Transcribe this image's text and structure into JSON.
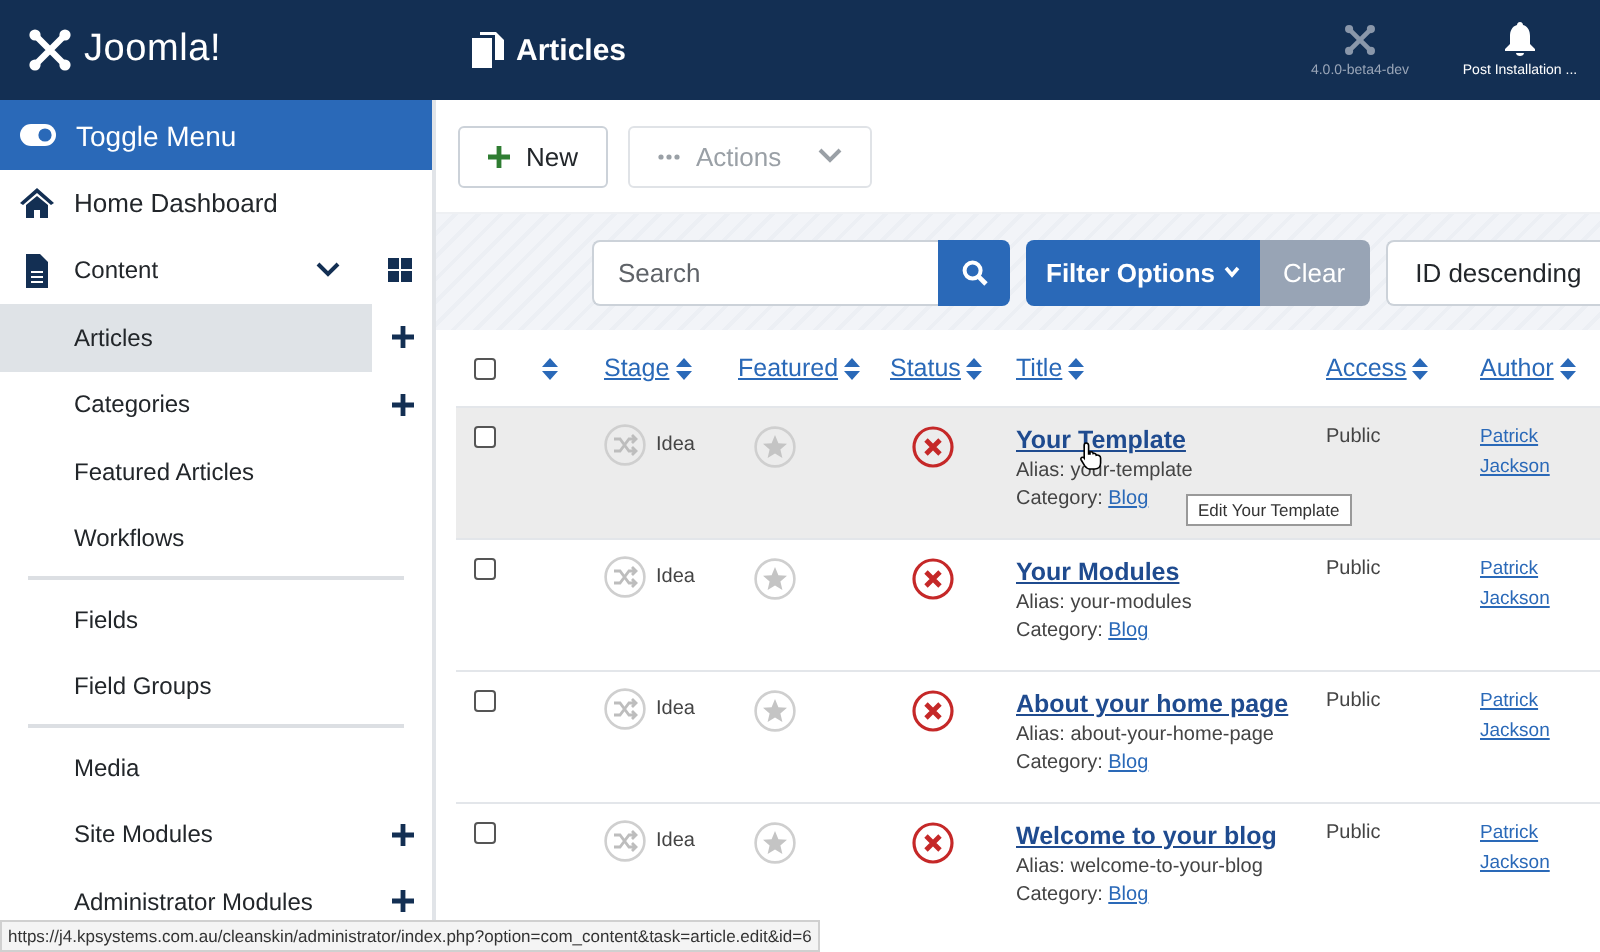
{
  "header": {
    "logo": "Joomla!",
    "title": "Articles",
    "version": "4.0.0-beta4-dev",
    "notifications": "Post Installation ..."
  },
  "sidebar": {
    "toggle": "Toggle Menu",
    "items": [
      {
        "kind": "home",
        "label": "Home Dashboard"
      },
      {
        "kind": "section",
        "label": "Content",
        "expanded": true,
        "children": [
          {
            "kind": "link",
            "label": "Articles",
            "selected": true,
            "add": true
          },
          {
            "kind": "link",
            "label": "Categories",
            "selected": false,
            "add": true
          },
          {
            "kind": "link",
            "label": "Featured Articles",
            "selected": false,
            "add": false
          },
          {
            "kind": "link",
            "label": "Workflows",
            "selected": false,
            "add": false
          },
          {
            "kind": "divider"
          },
          {
            "kind": "link",
            "label": "Fields",
            "selected": false,
            "add": false
          },
          {
            "kind": "link",
            "label": "Field Groups",
            "selected": false,
            "add": false
          },
          {
            "kind": "divider"
          },
          {
            "kind": "link",
            "label": "Media",
            "selected": false,
            "add": false
          },
          {
            "kind": "link",
            "label": "Site Modules",
            "selected": false,
            "add": true
          },
          {
            "kind": "link",
            "label": "Administrator Modules",
            "selected": false,
            "add": true
          }
        ]
      }
    ]
  },
  "toolbar": {
    "buttons": [
      {
        "kind": "new",
        "label": "New",
        "disabled": false
      },
      {
        "kind": "actions",
        "label": "Actions",
        "disabled": true
      }
    ]
  },
  "filters": {
    "search": {
      "placeholder": "Search"
    },
    "filter_options": "Filter Options",
    "clear": "Clear",
    "sort": "ID descending"
  },
  "table": {
    "columns": [
      {
        "kind": "check",
        "checked": false
      },
      {
        "kind": "order"
      },
      {
        "kind": "sort",
        "label": "Stage"
      },
      {
        "kind": "sort",
        "label": "Featured"
      },
      {
        "kind": "sort",
        "label": "Status"
      },
      {
        "kind": "sort",
        "label": "Title"
      },
      {
        "kind": "sort",
        "label": "Access"
      },
      {
        "kind": "sort",
        "label": "Author"
      }
    ],
    "rows": [
      {
        "checked": false,
        "hovered": true,
        "stage": "Idea",
        "featured": false,
        "published": false,
        "title": "Your Template",
        "alias": "Alias: your-template",
        "category_label": "Category:",
        "category": "Blog",
        "access": "Public",
        "author": "Patrick Jackson"
      },
      {
        "checked": false,
        "hovered": false,
        "stage": "Idea",
        "featured": false,
        "published": false,
        "title": "Your Modules",
        "alias": "Alias: your-modules",
        "category_label": "Category:",
        "category": "Blog",
        "access": "Public",
        "author": "Patrick Jackson"
      },
      {
        "checked": false,
        "hovered": false,
        "stage": "Idea",
        "featured": false,
        "published": false,
        "title": "About your home page",
        "alias": "Alias: about-your-home-page",
        "category_label": "Category:",
        "category": "Blog",
        "access": "Public",
        "author": "Patrick Jackson"
      },
      {
        "checked": false,
        "hovered": false,
        "stage": "Idea",
        "featured": false,
        "published": false,
        "title": "Welcome to your blog",
        "alias": "Alias: welcome-to-your-blog",
        "category_label": "Category:",
        "category": "Blog",
        "access": "Public",
        "author": "Patrick Jackson"
      }
    ]
  },
  "tooltip": "Edit Your Template",
  "status_bar": "https://j4.kpsystems.com.au/cleanskin/administrator/index.php?option=com_content&task=article.edit&id=6"
}
